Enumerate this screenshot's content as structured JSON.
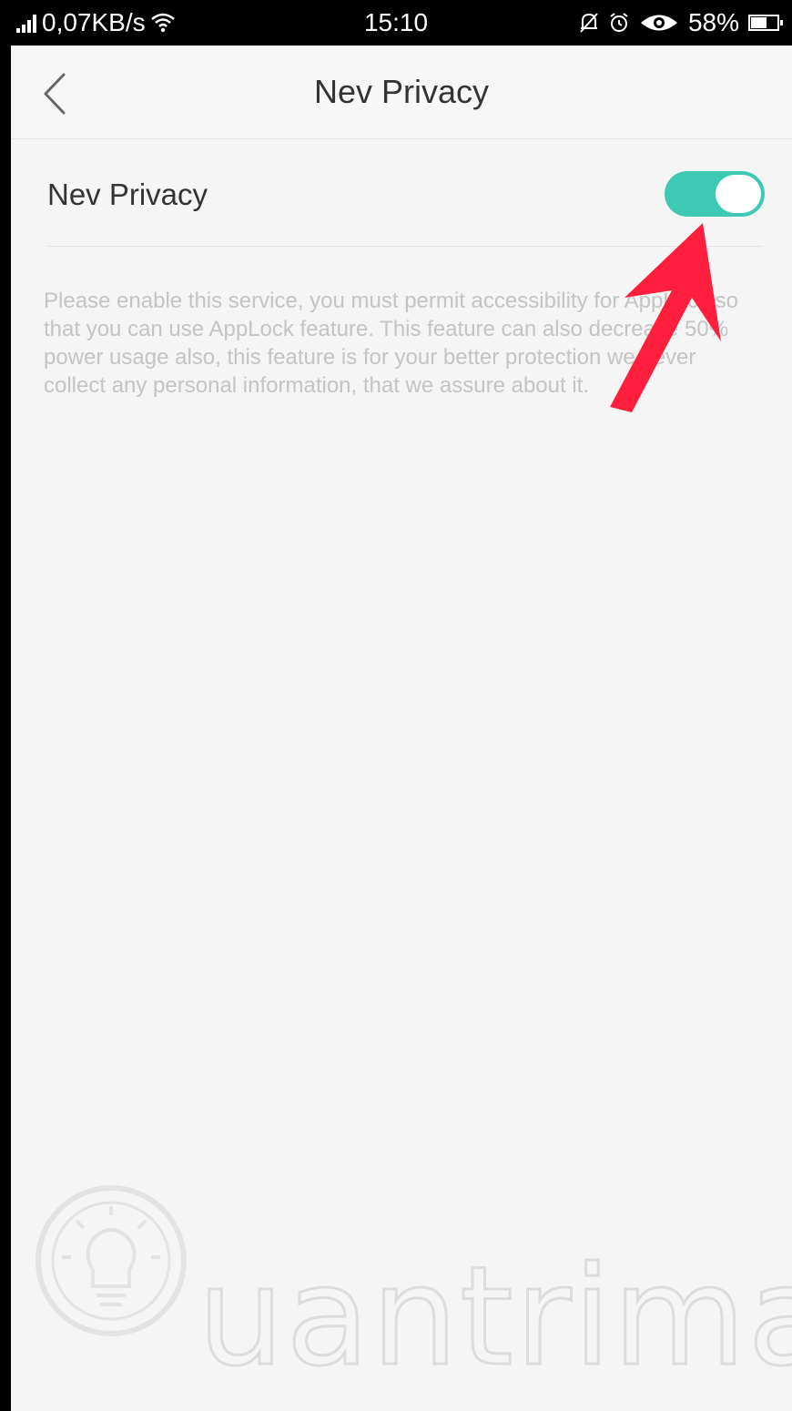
{
  "status_bar": {
    "network_speed": "0,07KB/s",
    "time": "15:10",
    "battery": "58%"
  },
  "nav": {
    "title": "Nev Privacy"
  },
  "setting": {
    "label": "Nev Privacy",
    "enabled": true
  },
  "description": "Please enable this service, you must permit accessibility for AppLock so that you can use AppLock feature. This feature can also decrease 50% power usage also, this feature is for your better protection we never collect any personal information, that we assure about it.",
  "watermark": "uantrimang",
  "colors": {
    "toggle_on": "#3ec9b4",
    "annotation_arrow": "#ff1f3d"
  }
}
